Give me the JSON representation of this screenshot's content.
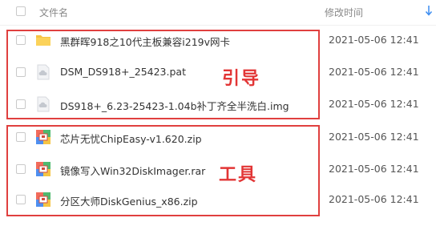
{
  "header": {
    "name_label": "文件名",
    "date_label": "修改时间",
    "sort_icon": "sort-down-arrow-icon"
  },
  "files": [
    {
      "name": "黑群晖918之10代主板兼容i219v网卡",
      "date": "2021-05-06 12:41",
      "icon": "folder-icon"
    },
    {
      "name": "DSM_DS918+_25423.pat",
      "date": "2021-05-06 12:41",
      "icon": "cloud-file-icon"
    },
    {
      "name": "DS918+_6.23-25423-1.04b补丁齐全半洗白.img",
      "date": "2021-05-06 12:41",
      "icon": "cloud-file-icon"
    },
    {
      "name": "芯片无忧ChipEasy-v1.620.zip",
      "date": "2021-05-06 12:41",
      "icon": "zip-archive-icon"
    },
    {
      "name": "镜像写入Win32DiskImager.rar",
      "date": "2021-05-06 12:41",
      "icon": "zip-archive-icon"
    },
    {
      "name": "分区大师DiskGenius_x86.zip",
      "date": "2021-05-06 12:41",
      "icon": "zip-archive-icon"
    }
  ],
  "annotations": {
    "group1_label": "引导",
    "group2_label": "工具",
    "accent_color": "#e0403f"
  }
}
